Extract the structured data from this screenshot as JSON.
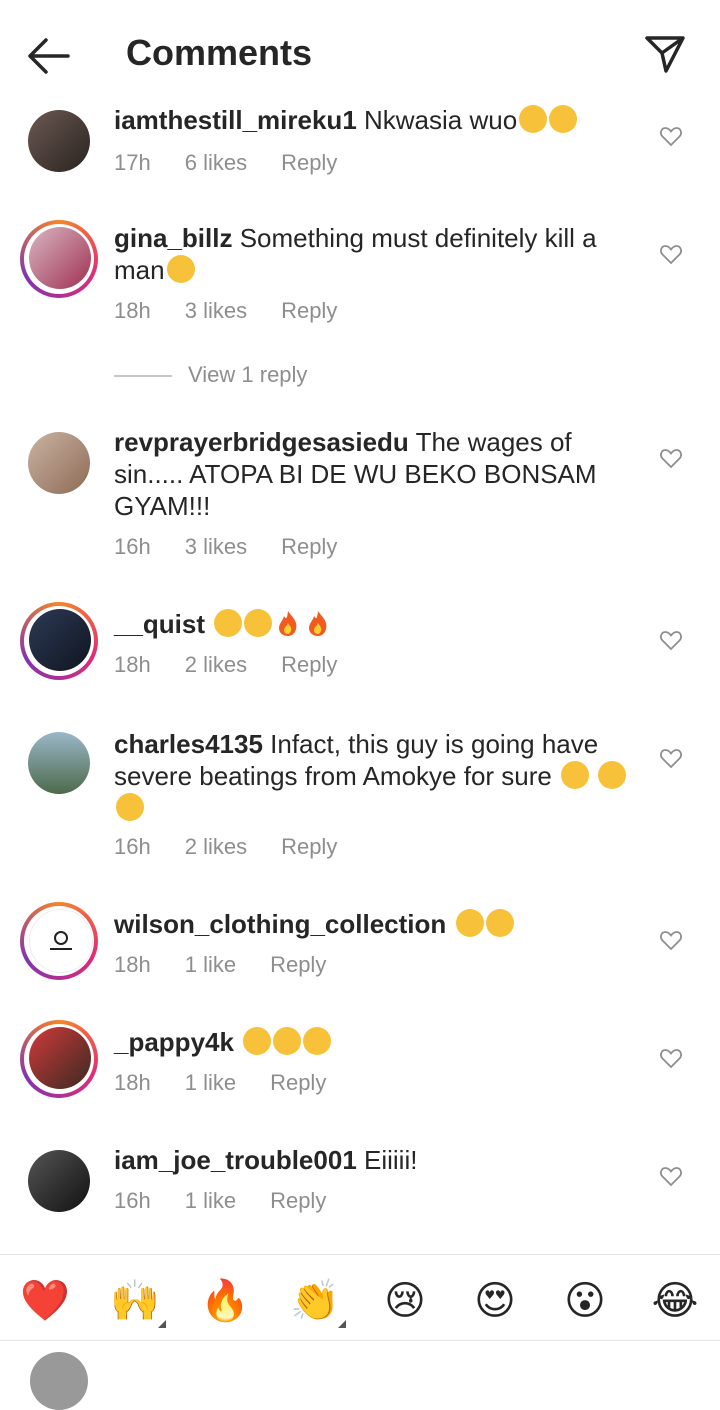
{
  "header": {
    "title": "Comments"
  },
  "comments": [
    {
      "user": "iamthestill_mireku1",
      "text": " Nkwasia wuo",
      "emojis": 2,
      "time": "17h",
      "likes": "6 likes",
      "reply": "Reply"
    },
    {
      "user": "gina_billz",
      "text": " Something must definitely kill a man",
      "emojis": 1,
      "time": "18h",
      "likes": "3 likes",
      "reply": "Reply"
    },
    {
      "user": "revprayerbridgesasiedu",
      "text": " The wages of sin..... ATOPA BI DE WU BEKO BONSAM GYAM!!!",
      "time": "16h",
      "likes": "3 likes",
      "reply": "Reply"
    },
    {
      "user": "__quist",
      "text": " ",
      "time": "18h",
      "likes": "2 likes",
      "reply": "Reply"
    },
    {
      "user": "charles4135",
      "text": " Infact, this guy is going have severe beatings from Amokye  for sure ",
      "time": "16h",
      "likes": "2 likes",
      "reply": "Reply"
    },
    {
      "user": "wilson_clothing_collection",
      "text": " ",
      "time": "18h",
      "likes": "1 like",
      "reply": "Reply"
    },
    {
      "user": "_pappy4k",
      "text": " ",
      "time": "18h",
      "likes": "1 like",
      "reply": "Reply"
    },
    {
      "user": "iam_joe_trouble001",
      "text": " Eiiiii!",
      "time": "16h",
      "likes": "1 like",
      "reply": "Reply"
    }
  ],
  "view_reply": "View 1 reply",
  "reactions": [
    "❤️",
    "🙌",
    "🔥",
    "👏",
    "😢",
    "😍",
    "😮",
    "😂"
  ],
  "colors": {
    "text": "#262626",
    "meta": "#8e8e8e",
    "heart": "#ed4956"
  }
}
